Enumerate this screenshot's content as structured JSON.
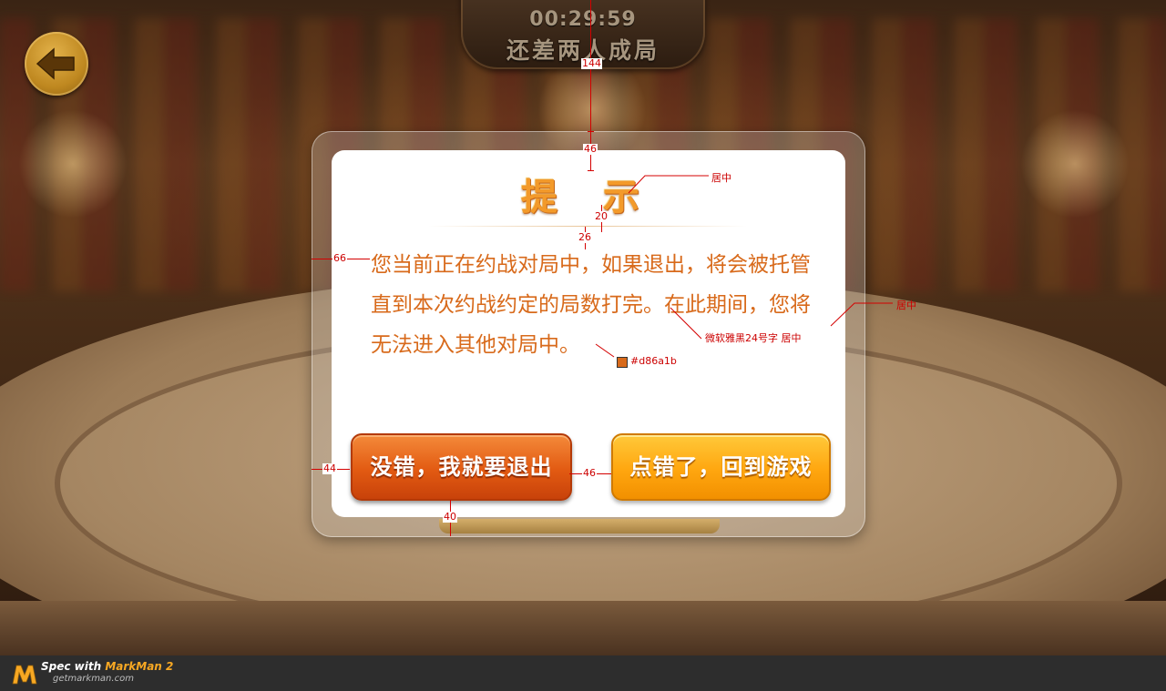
{
  "header": {
    "timer": "00:29:59",
    "status": "还差两人成局"
  },
  "back_button": {
    "icon": "arrow-left-icon"
  },
  "dialog": {
    "title": "提 示",
    "message": "您当前正在约战对局中，如果退出，将会被托管直到本次约战约定的局数打完。在此期间，您将无法进入其他对局中。",
    "quit_label": "没错，我就要退出",
    "return_label": "点错了，回到游戏",
    "text_color": "#d86a1b"
  },
  "annotations": {
    "dist_top": "144",
    "dist_title_top": "46",
    "dist_title_line": "20",
    "dist_text_top": "26",
    "dist_text_left": "66",
    "dist_btn_left": "44",
    "dist_btn_gap": "46",
    "dist_btn_bottom": "40",
    "title_note": "居中",
    "dialog_note": "居中",
    "font_note": "微软雅黑24号字  居中",
    "color_note": "#d86a1b"
  },
  "footer": {
    "spec_prefix": "Spec with ",
    "brand": "MarkMan 2",
    "url": "getmarkman.com"
  }
}
